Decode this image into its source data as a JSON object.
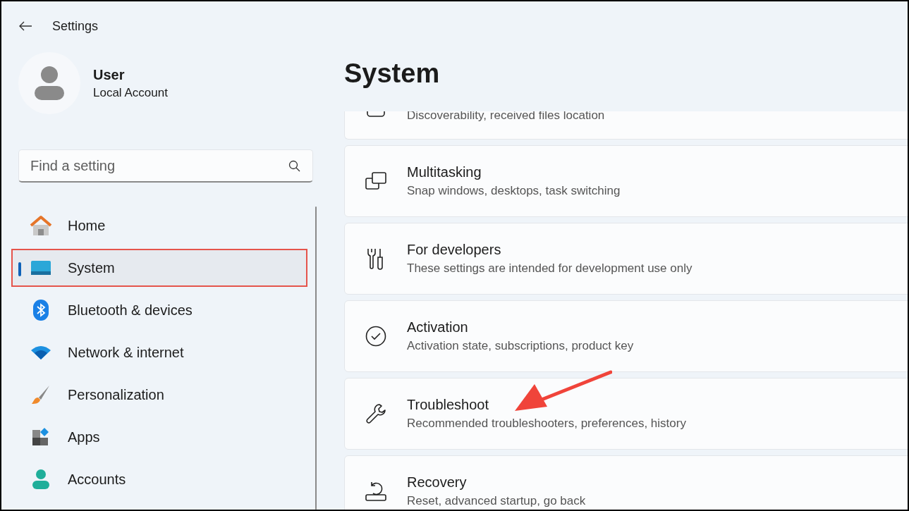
{
  "window": {
    "title": "Settings"
  },
  "user": {
    "name": "User",
    "account": "Local Account"
  },
  "search": {
    "placeholder": "Find a setting"
  },
  "nav": [
    {
      "label": "Home",
      "selected": false,
      "highlighted": false
    },
    {
      "label": "System",
      "selected": true,
      "highlighted": true
    },
    {
      "label": "Bluetooth & devices",
      "selected": false,
      "highlighted": false
    },
    {
      "label": "Network & internet",
      "selected": false,
      "highlighted": false
    },
    {
      "label": "Personalization",
      "selected": false,
      "highlighted": false
    },
    {
      "label": "Apps",
      "selected": false,
      "highlighted": false
    },
    {
      "label": "Accounts",
      "selected": false,
      "highlighted": false
    }
  ],
  "page": {
    "title": "System"
  },
  "cards": [
    {
      "kind": "partial",
      "subtitle": "Discoverability, received files location",
      "pointed": false
    },
    {
      "kind": "full",
      "title": "Multitasking",
      "subtitle": "Snap windows, desktops, task switching",
      "pointed": false
    },
    {
      "kind": "full",
      "title": "For developers",
      "subtitle": "These settings are intended for development use only",
      "pointed": false
    },
    {
      "kind": "full",
      "title": "Activation",
      "subtitle": "Activation state, subscriptions, product key",
      "pointed": false
    },
    {
      "kind": "full",
      "title": "Troubleshoot",
      "subtitle": "Recommended troubleshooters, preferences, history",
      "pointed": true
    },
    {
      "kind": "full",
      "title": "Recovery",
      "subtitle": "Reset, advanced startup, go back",
      "pointed": false
    }
  ]
}
